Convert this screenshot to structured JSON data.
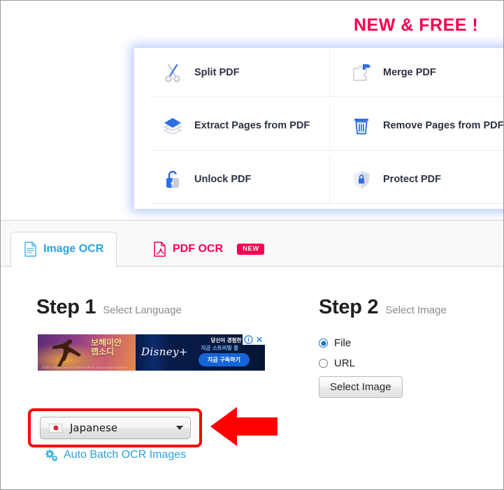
{
  "promo": {
    "headline": "NEW & FREE !",
    "headline_color": "#f5004f"
  },
  "tools_panel": {
    "items": [
      {
        "label": "Split PDF",
        "icon": "scissors-icon"
      },
      {
        "label": "Merge PDF",
        "icon": "puzzle-merge-icon"
      },
      {
        "label": "Extract Pages from PDF",
        "icon": "layers-icon"
      },
      {
        "label": "Remove Pages from PDF",
        "icon": "trash-icon"
      },
      {
        "label": "Unlock PDF",
        "icon": "unlock-icon"
      },
      {
        "label": "Protect PDF",
        "icon": "shield-lock-icon"
      }
    ]
  },
  "tabs": [
    {
      "label": "Image OCR",
      "icon": "document-text-icon",
      "active": true,
      "color": "#2ca0dd",
      "badge": ""
    },
    {
      "label": "PDF OCR",
      "icon": "pdf-file-icon",
      "active": false,
      "color": "#f5004f",
      "badge": "NEW"
    }
  ],
  "step1": {
    "title": "Step 1",
    "subtitle": "Select Language",
    "language_select": {
      "value": "Japanese",
      "flag": "jp-flag-icon"
    },
    "batch_link": {
      "label": "Auto Batch OCR Images",
      "icon": "gears-icon",
      "color": "#2ca0dd"
    }
  },
  "step2": {
    "title": "Step 2",
    "subtitle": "Select Image",
    "source_options": [
      {
        "label": "File",
        "checked": true
      },
      {
        "label": "URL",
        "checked": false
      }
    ],
    "select_image_button": "Select Image"
  },
  "advertisement": {
    "left_panel": {
      "title_line1": "보헤미안",
      "title_line2": "랩소디",
      "fineprint": "©2021 Disney and its related entities. Subscription required."
    },
    "right_panel": {
      "brand": "Disney+",
      "line1": "당신이 경험한 적",
      "line2": "지금 스트리밍 중",
      "cta": "지금 구독하기"
    },
    "controls": {
      "adchoices": "ⓘ",
      "close": "✕"
    }
  },
  "annotations": {
    "highlight_box_color": "#ff0000",
    "arrow_color": "#ff0000",
    "arrow_direction": "left"
  }
}
